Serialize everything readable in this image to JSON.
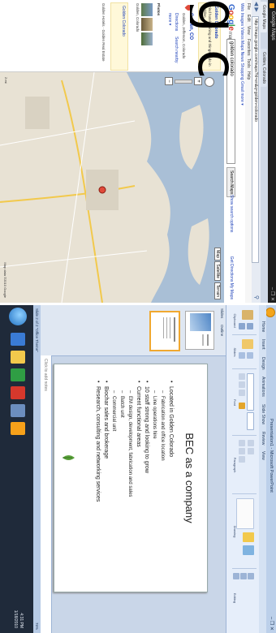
{
  "overlay_text": "g c",
  "maps_window": {
    "title": "Google Maps",
    "controls": "– ❐ ✕",
    "tabs": [
      "Google Maps",
      "Golden, Colorado"
    ],
    "nav": "◀ ▶",
    "url": "http://maps.google.com/maps?hl=en&q=golden+colorado",
    "menu": [
      "File",
      "Edit",
      "View",
      "Favorites",
      "Tools",
      "Help"
    ],
    "links_bar": "Web  Images  Videos  Maps  News  Shopping  Gmail  more ▾",
    "search_value": "golden colorado",
    "search_button": "Search Maps",
    "search_options": "Show search options",
    "search_right": "Get Directions  My Maps",
    "logo": [
      {
        "ch": "G",
        "color": "#3366cc"
      },
      {
        "ch": "o",
        "color": "#d6382c"
      },
      {
        "ch": "o",
        "color": "#f5b400"
      },
      {
        "ch": "g",
        "color": "#3366cc"
      },
      {
        "ch": "l",
        "color": "#2f9e44"
      },
      {
        "ch": "e",
        "color": "#d6382c"
      },
      {
        "ch": " maps",
        "color": "#555555"
      }
    ],
    "sidebar": {
      "ad_title": "Golden Colorado",
      "ad_text": "Find hotels, dining and things to do in Golden",
      "result_title": "Golden, CO",
      "result_text": "Golden, Jefferson, Colorado",
      "links": [
        "Directions",
        "Search nearby",
        "more ▾"
      ],
      "photos_label": "Photos",
      "photo_caption": "Golden, Colorado",
      "related": "Golden Colorado",
      "feedback": "Golden Hotels · Golden Real Estate"
    },
    "map_types": [
      "Map",
      "Satellite",
      "Terrain"
    ],
    "scale": "2 mi",
    "copyright": "Map data ©2010 Google"
  },
  "ppt_window": {
    "title": "Presentation1 - Microsoft PowerPoint",
    "controls": "– ❐ ✕",
    "ribbon_tabs": [
      "Home",
      "Insert",
      "Design",
      "Animations",
      "Slide Show",
      "Review",
      "View"
    ],
    "ribbon_groups": [
      "Clipboard",
      "Slides",
      "Font",
      "Paragraph",
      "Drawing",
      "Editing"
    ],
    "pane_tabs": [
      "Slides",
      "Outline"
    ],
    "slide_title": "BEC as a company",
    "slide_bullets": [
      {
        "text": "Located in Golden Colorado",
        "level": 1
      },
      {
        "text": "Fabrication and office location",
        "level": 2
      },
      {
        "text": "Line operations hire",
        "level": 2
      },
      {
        "text": "10 staff strong and looking to grow",
        "level": 1
      },
      {
        "text": "Current functional areas",
        "level": 1
      },
      {
        "text": "EM design, development, fabrication and sales",
        "level": 2
      },
      {
        "text": "Batch unit",
        "level": 2
      },
      {
        "text": "Commercial unit",
        "level": 2
      },
      {
        "text": "Biochar sales and brokerage",
        "level": 1
      },
      {
        "text": "Research, consulting and networking services",
        "level": 1
      }
    ],
    "notes_placeholder": "Click to add notes",
    "status_left": "Slide 2 of 2   \"Office Theme\"",
    "status_right": "76%",
    "clock_time": "4:31 PM",
    "clock_date": "1/18/2010"
  },
  "colors": {
    "accent": "#1f6fc1",
    "map_land": "#e8e2d4",
    "map_water": "#a9bfd6"
  }
}
